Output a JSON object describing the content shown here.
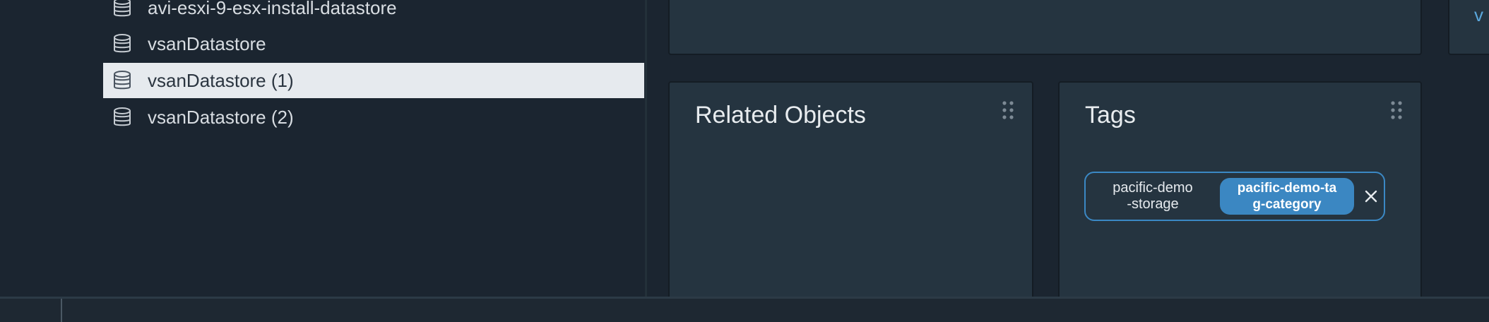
{
  "datastore_tree": {
    "items": [
      {
        "label": "avi-esxi-9-esx-install-datastore",
        "icon": "datastore-icon",
        "selected": false
      },
      {
        "label": "vsanDatastore",
        "icon": "datastore-icon",
        "selected": false
      },
      {
        "label": "vsanDatastore (1)",
        "icon": "datastore-icon",
        "selected": true
      },
      {
        "label": "vsanDatastore (2)",
        "icon": "datastore-icon",
        "selected": false
      }
    ]
  },
  "cards": {
    "related_objects": {
      "title": "Related Objects"
    },
    "tags": {
      "title": "Tags",
      "tag": {
        "name": "pacific-demo\n-storage",
        "category": "pacific-demo-ta\ng-category"
      }
    }
  },
  "edge_link_text": "v",
  "colors": {
    "background": "#1b2530",
    "card": "#253440",
    "selected_row": "#e6eaee",
    "accent": "#3b87c2"
  }
}
